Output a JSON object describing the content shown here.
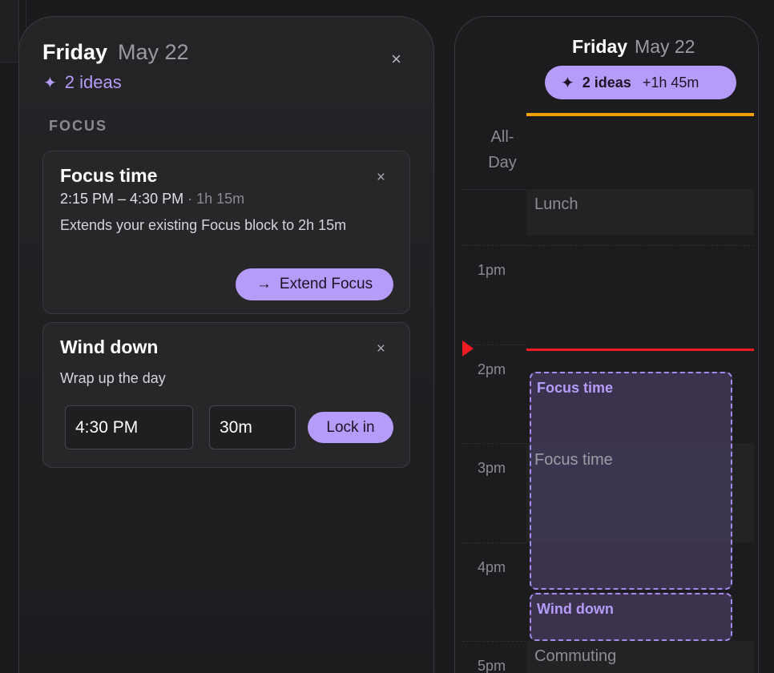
{
  "ideas_panel": {
    "day": "Friday",
    "date": "May 22",
    "close_icon": "×",
    "ideas_count_label": "2 ideas",
    "sparkle_icon": "✦",
    "section_label": "FOCUS",
    "cards": [
      {
        "title": "Focus time",
        "time_range": "2:15 PM – 4:30 PM",
        "separator": " · ",
        "duration": "1h 15m",
        "description": "Extends your existing Focus block to 2h 15m",
        "action_arrow": "→",
        "action_label": "Extend Focus"
      },
      {
        "title": "Wind down",
        "description": "Wrap up the day",
        "start_time_value": "4:30 PM",
        "duration_value": "30m",
        "action_label": "Lock in"
      }
    ]
  },
  "calendar": {
    "day": "Friday",
    "date": "May 22",
    "ideas_pill": {
      "label": "2 ideas",
      "extra": "+1h 45m"
    },
    "all_day_label": "All-Day",
    "hours": [
      "1pm",
      "2pm",
      "3pm",
      "4pm",
      "5pm"
    ],
    "events": {
      "lunch": "Lunch",
      "focus": "Focus time",
      "commuting": "Commuting"
    },
    "ideas_blocks": {
      "focus": "Focus time",
      "wind_down": "Wind down"
    }
  },
  "colors": {
    "accent": "#b69cf9",
    "now_indicator": "#ee1c22",
    "today_bar": "#f59f0b",
    "background": "#1b1a1d"
  }
}
